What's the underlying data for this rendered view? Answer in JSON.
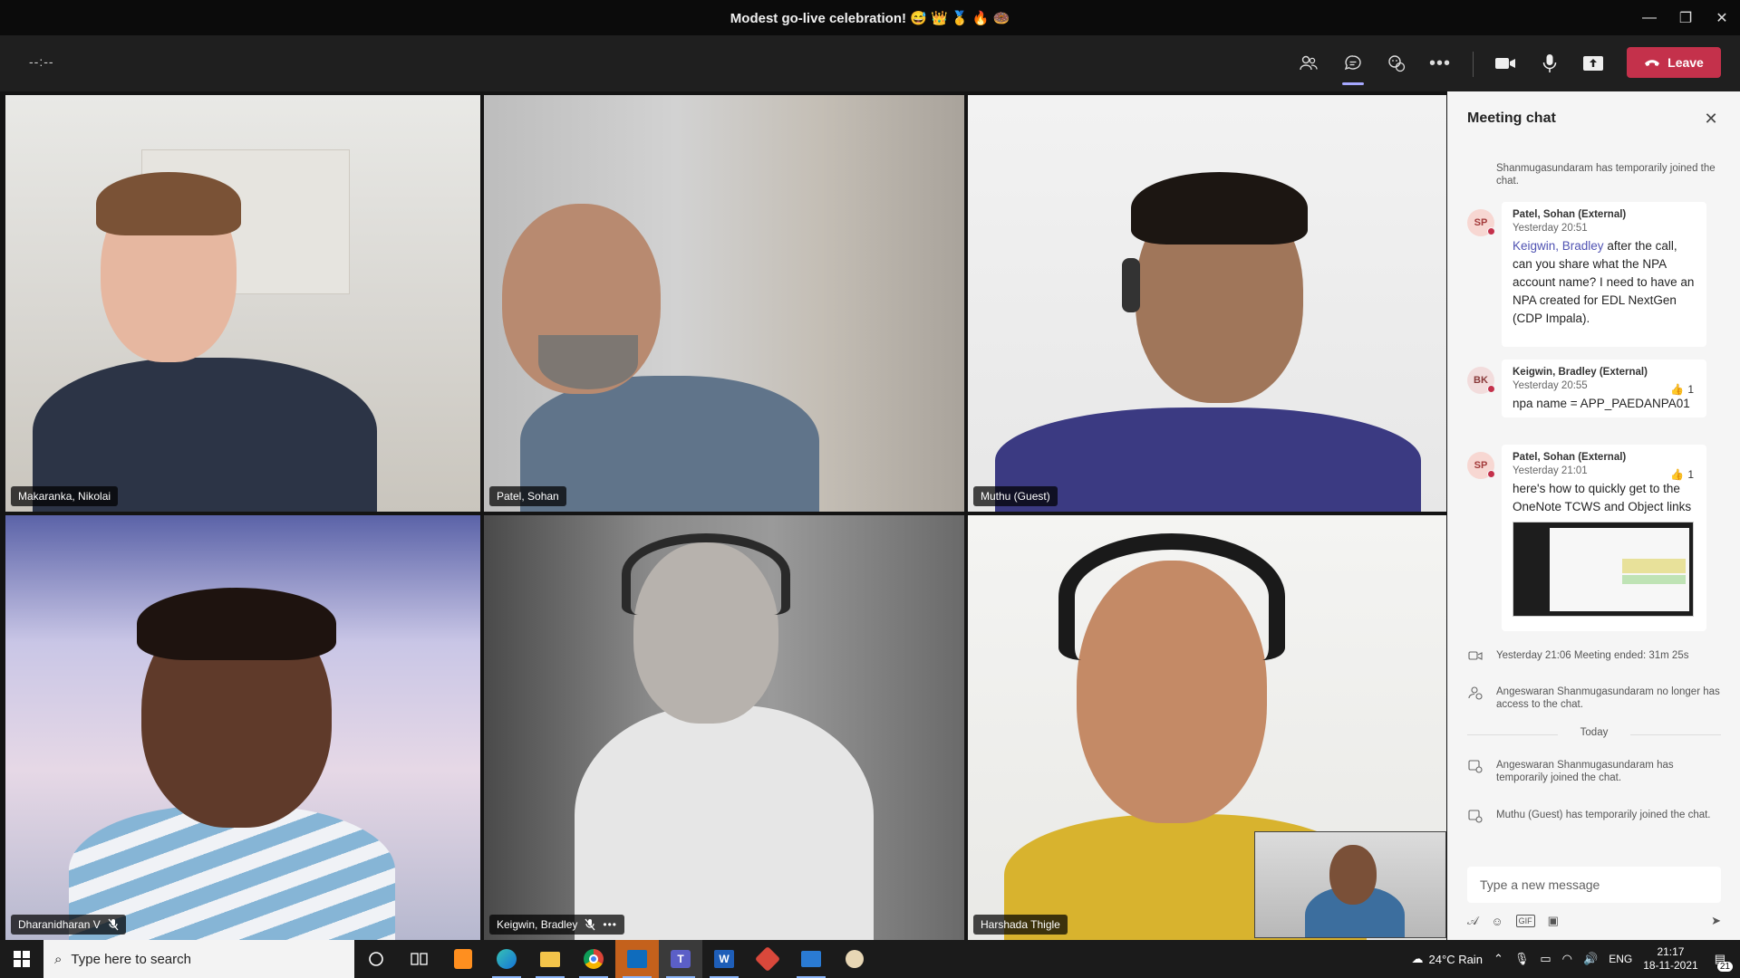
{
  "window": {
    "title": "Modest go-live celebration! 😅 👑 🥇 🔥 🍩"
  },
  "toolbar": {
    "timer": "--:--",
    "leave_label": "Leave",
    "colors": {
      "leave": "#c4314b",
      "accent": "#a6a8ff"
    }
  },
  "participants": [
    {
      "name": "Makaranka, Nikolai",
      "muted": false,
      "speaking": true
    },
    {
      "name": "Patel, Sohan",
      "muted": false,
      "speaking": false
    },
    {
      "name": "Muthu (Guest)",
      "muted": false,
      "speaking": false
    },
    {
      "name": "Dharanidharan V",
      "muted": true,
      "speaking": false
    },
    {
      "name": "Keigwin, Bradley",
      "muted": true,
      "speaking": false
    },
    {
      "name": "Harshada Thigle",
      "muted": false,
      "speaking": true
    }
  ],
  "chat": {
    "title": "Meeting chat",
    "system_top": "Shanmugasundaram has temporarily joined the chat.",
    "messages": [
      {
        "initials": "SP",
        "avatar_color": "#f7d7d2",
        "author": "Patel, Sohan (External)",
        "time": "Yesterday 20:51",
        "mention": "Keigwin, Bradley",
        "text": " after the call, can you share what the NPA account name? I need to have an NPA created for EDL NextGen (CDP Impala)."
      },
      {
        "initials": "BK",
        "avatar_color": "#f2dcdc",
        "author": "Keigwin, Bradley (External)",
        "time": "Yesterday 20:55",
        "reaction": "👍",
        "reaction_count": "1",
        "text": "npa name = APP_PAEDANPA01"
      },
      {
        "initials": "SP",
        "avatar_color": "#f7d7d2",
        "author": "Patel, Sohan (External)",
        "time": "Yesterday 21:01",
        "reaction": "👍",
        "reaction_count": "1",
        "text": "here's how to quickly get to the OneNote TCWS and Object links"
      }
    ],
    "meeting_ended": "Yesterday 21:06   Meeting ended: 31m 25s",
    "no_access": "Angeswaran Shanmugasundaram no longer has access to the chat.",
    "today": "Today",
    "rejoined": "Angeswaran Shanmugasundaram has temporarily joined the chat.",
    "guest_joined": "Muthu (Guest) has temporarily joined the chat.",
    "compose_placeholder": "Type a new message"
  },
  "taskbar": {
    "search_placeholder": "Type here to search",
    "apps": [
      "cortana-icon",
      "task-view-icon",
      "sublime-icon",
      "edge-icon",
      "file-explorer-icon",
      "chrome-icon",
      "outlook-icon",
      "teams-icon",
      "word-icon",
      "app-red-icon",
      "photos-icon",
      "paint-icon"
    ],
    "weather": "24°C  Rain",
    "language": "ENG",
    "time": "21:17",
    "date": "18-11-2021",
    "notifications": "21"
  }
}
